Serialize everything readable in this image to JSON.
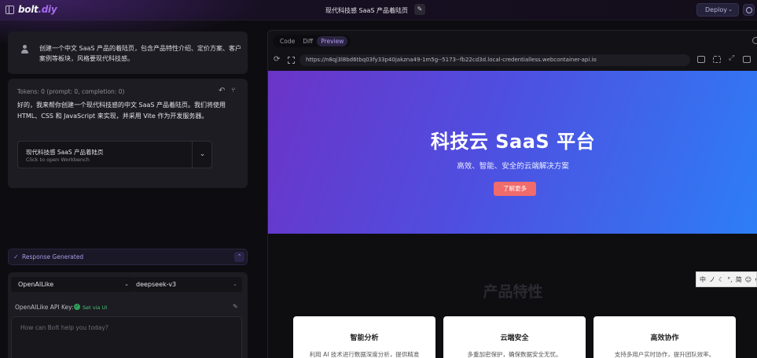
{
  "topbar": {
    "logo_main": "bolt",
    "logo_suffix": ".diy",
    "title": "现代科技感 SaaS 产品着陆页",
    "deploy_label": "Deploy"
  },
  "chat": {
    "user_message": "创建一个中文 SaaS 产品的着陆页，包含产品特性介绍、定价方案、客户案例等板块，风格要现代科技感。",
    "tokens": "Tokens: 0 (prompt: 0, completion: 0)",
    "ai_message": "好的，我来帮你创建一个现代科技感的中文 SaaS 产品着陆页。我们将使用 HTML、CSS 和 JavaScript 来实现，并采用 Vite 作为开发服务器。",
    "artifact": {
      "title": "现代科技感 SaaS 产品着陆页",
      "subtitle": "Click to open Workbench"
    },
    "response_status": "Response Generated"
  },
  "input": {
    "provider": "OpenAILike",
    "model": "deepseek-v3",
    "api_key_label": "OpenAILike API Key:",
    "api_key_status": "Set via UI",
    "placeholder": "How can Bolt help you today?"
  },
  "workbench": {
    "tabs": [
      {
        "label": "Code",
        "active": false
      },
      {
        "label": "Diff",
        "active": false
      },
      {
        "label": "Preview",
        "active": true
      }
    ],
    "url": "https://n8qj3l8bd6tbq03fy33p40jakzna49-1m5g--5173--fb22cd3d.local-credentialless.webcontainer-api.io"
  },
  "preview": {
    "hero_title": "科技云 SaaS 平台",
    "hero_subtitle": "高效、智能、安全的云端解决方案",
    "hero_button": "了解更多",
    "features_title": "产品特性",
    "features": [
      {
        "name": "智能分析",
        "desc": "利用 AI 技术进行数据深度分析，提供精准"
      },
      {
        "name": "云端安全",
        "desc": "多重加密保护，确保数据安全无忧。"
      },
      {
        "name": "高效协作",
        "desc": "支持多用户实时协作，提升团队效率。"
      }
    ]
  },
  "ime": {
    "items": [
      "中",
      "ノ",
      "☾",
      "°,",
      "简",
      "☺",
      "⚙"
    ]
  },
  "colors": {
    "accent": "#a56cf0",
    "hero_start": "#6b34c8",
    "hero_end": "#2d7ef6",
    "cta": "#f06b6b",
    "success": "#2fa35b"
  }
}
